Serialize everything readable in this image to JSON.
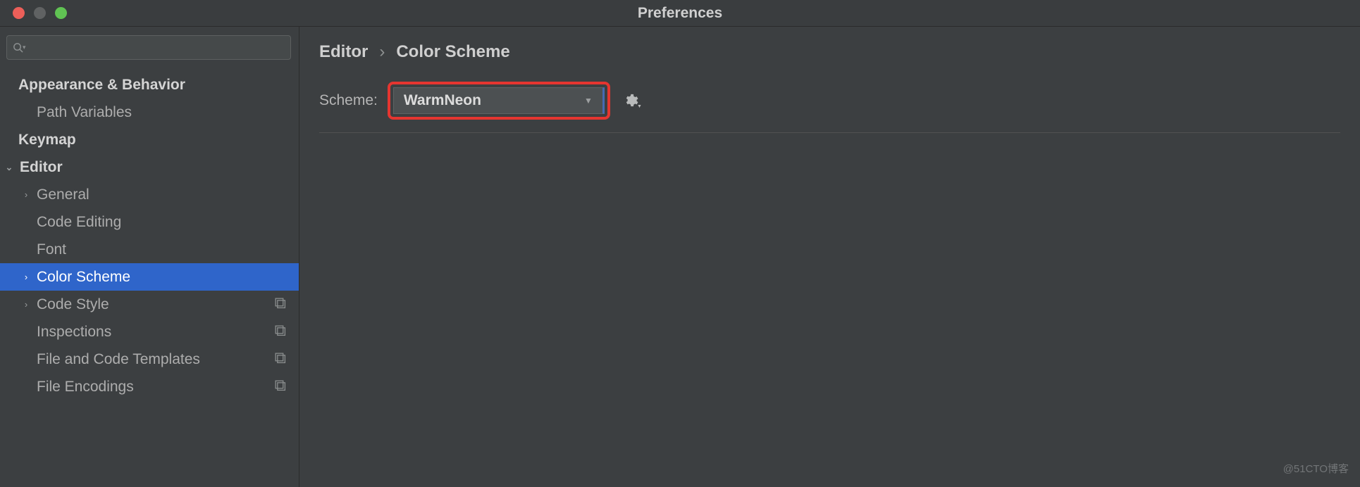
{
  "window": {
    "title": "Preferences"
  },
  "search": {
    "value": ""
  },
  "sidebar": {
    "items": [
      {
        "label": "Appearance & Behavior",
        "type": "cat",
        "indent": "indent-0"
      },
      {
        "label": "Path Variables",
        "type": "sub",
        "indent": "indent-1"
      },
      {
        "label": "Keymap",
        "type": "cat",
        "indent": "indent-0"
      },
      {
        "label": "Editor",
        "type": "cat",
        "indent": "indent-expand-0",
        "expanded": true
      },
      {
        "label": "General",
        "type": "sub",
        "indent": "indent-expand-1",
        "expandable": true
      },
      {
        "label": "Code Editing",
        "type": "sub",
        "indent": "indent-1"
      },
      {
        "label": "Font",
        "type": "sub",
        "indent": "indent-1"
      },
      {
        "label": "Color Scheme",
        "type": "sub",
        "indent": "indent-expand-1",
        "expandable": true,
        "selected": true
      },
      {
        "label": "Code Style",
        "type": "sub",
        "indent": "indent-expand-1",
        "expandable": true,
        "profile": true
      },
      {
        "label": "Inspections",
        "type": "sub",
        "indent": "indent-1",
        "profile": true
      },
      {
        "label": "File and Code Templates",
        "type": "sub",
        "indent": "indent-1",
        "profile": true
      },
      {
        "label": "File Encodings",
        "type": "sub",
        "indent": "indent-1",
        "profile": true
      }
    ]
  },
  "breadcrumb": {
    "parts": [
      "Editor",
      "Color Scheme"
    ],
    "sep": "›"
  },
  "main": {
    "scheme_label": "Scheme:",
    "scheme_value": "WarmNeon"
  },
  "watermark": "@51CTO博客"
}
